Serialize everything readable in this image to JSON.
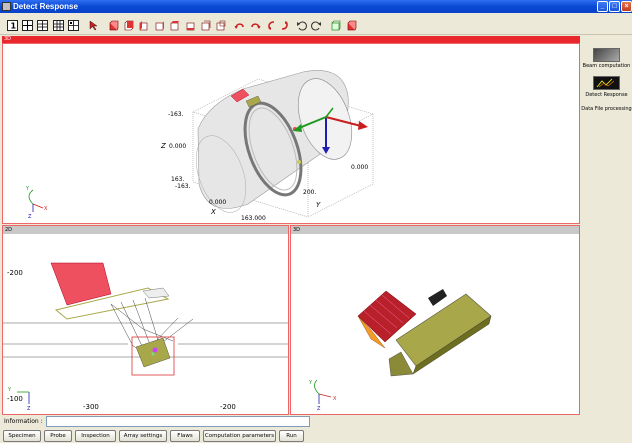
{
  "window": {
    "title": "Detect Response"
  },
  "toolbar": {
    "view_layout_icons": [
      "layout-1-icon",
      "layout-4-icon",
      "layout-6-icon",
      "layout-9-icon",
      "layout-grid-icon"
    ],
    "tool_icons": [
      "select-icon",
      "view-front-icon",
      "view-back-icon",
      "view-left-icon",
      "view-right-icon",
      "view-top-icon",
      "view-bottom-icon",
      "view-iso-icon",
      "rotate-ccw-icon",
      "rotate-cw-icon",
      "rotate-left-icon",
      "rotate-right-icon",
      "undo-icon",
      "redo-icon",
      "zoom-icon",
      "reset-icon"
    ]
  },
  "panes": {
    "top": {
      "label": "3D"
    },
    "bottom_left": {
      "label": "2D"
    },
    "bottom_right": {
      "label": "3D"
    }
  },
  "top_view_labels": {
    "z_axis_title": "Z",
    "z_tick_top": "-163.",
    "z_tick_mid": "0.000",
    "z_tick_low": "163.",
    "z_tick_low2": "-163.",
    "x_axis_title": "X",
    "x_tick_mid": "0.000",
    "x_tick_low": "163.000",
    "x_tick_top": "163.",
    "y_axis_title": "Y",
    "y_tick_mid": "200.",
    "y_tick_end": "0.000"
  },
  "axes_triad": {
    "x": "X",
    "y": "Y",
    "z": "Z"
  },
  "bottom_left_view_labels": {
    "y_tick_top": "-200",
    "y_tick_bottom": "-100",
    "x_tick_left": "-300",
    "x_tick_right": "-200"
  },
  "right_panel": {
    "items": [
      {
        "label": "Beam computation"
      },
      {
        "label": "Detect Response"
      },
      {
        "label": "Data File processing"
      }
    ]
  },
  "info": {
    "label": "Information :",
    "value": ""
  },
  "tabs": [
    "Specimen",
    "Probe",
    "Inspection",
    "Array settings",
    "Flaws",
    "Computation parameters",
    "Run"
  ],
  "colors": {
    "accent_red": "#e8282c",
    "axis_red": "#c81e1e",
    "axis_green": "#1e9a1e",
    "axis_blue": "#1e1eb4",
    "probe_olive": "#a8a84a",
    "probe_red": "#ee5060"
  }
}
